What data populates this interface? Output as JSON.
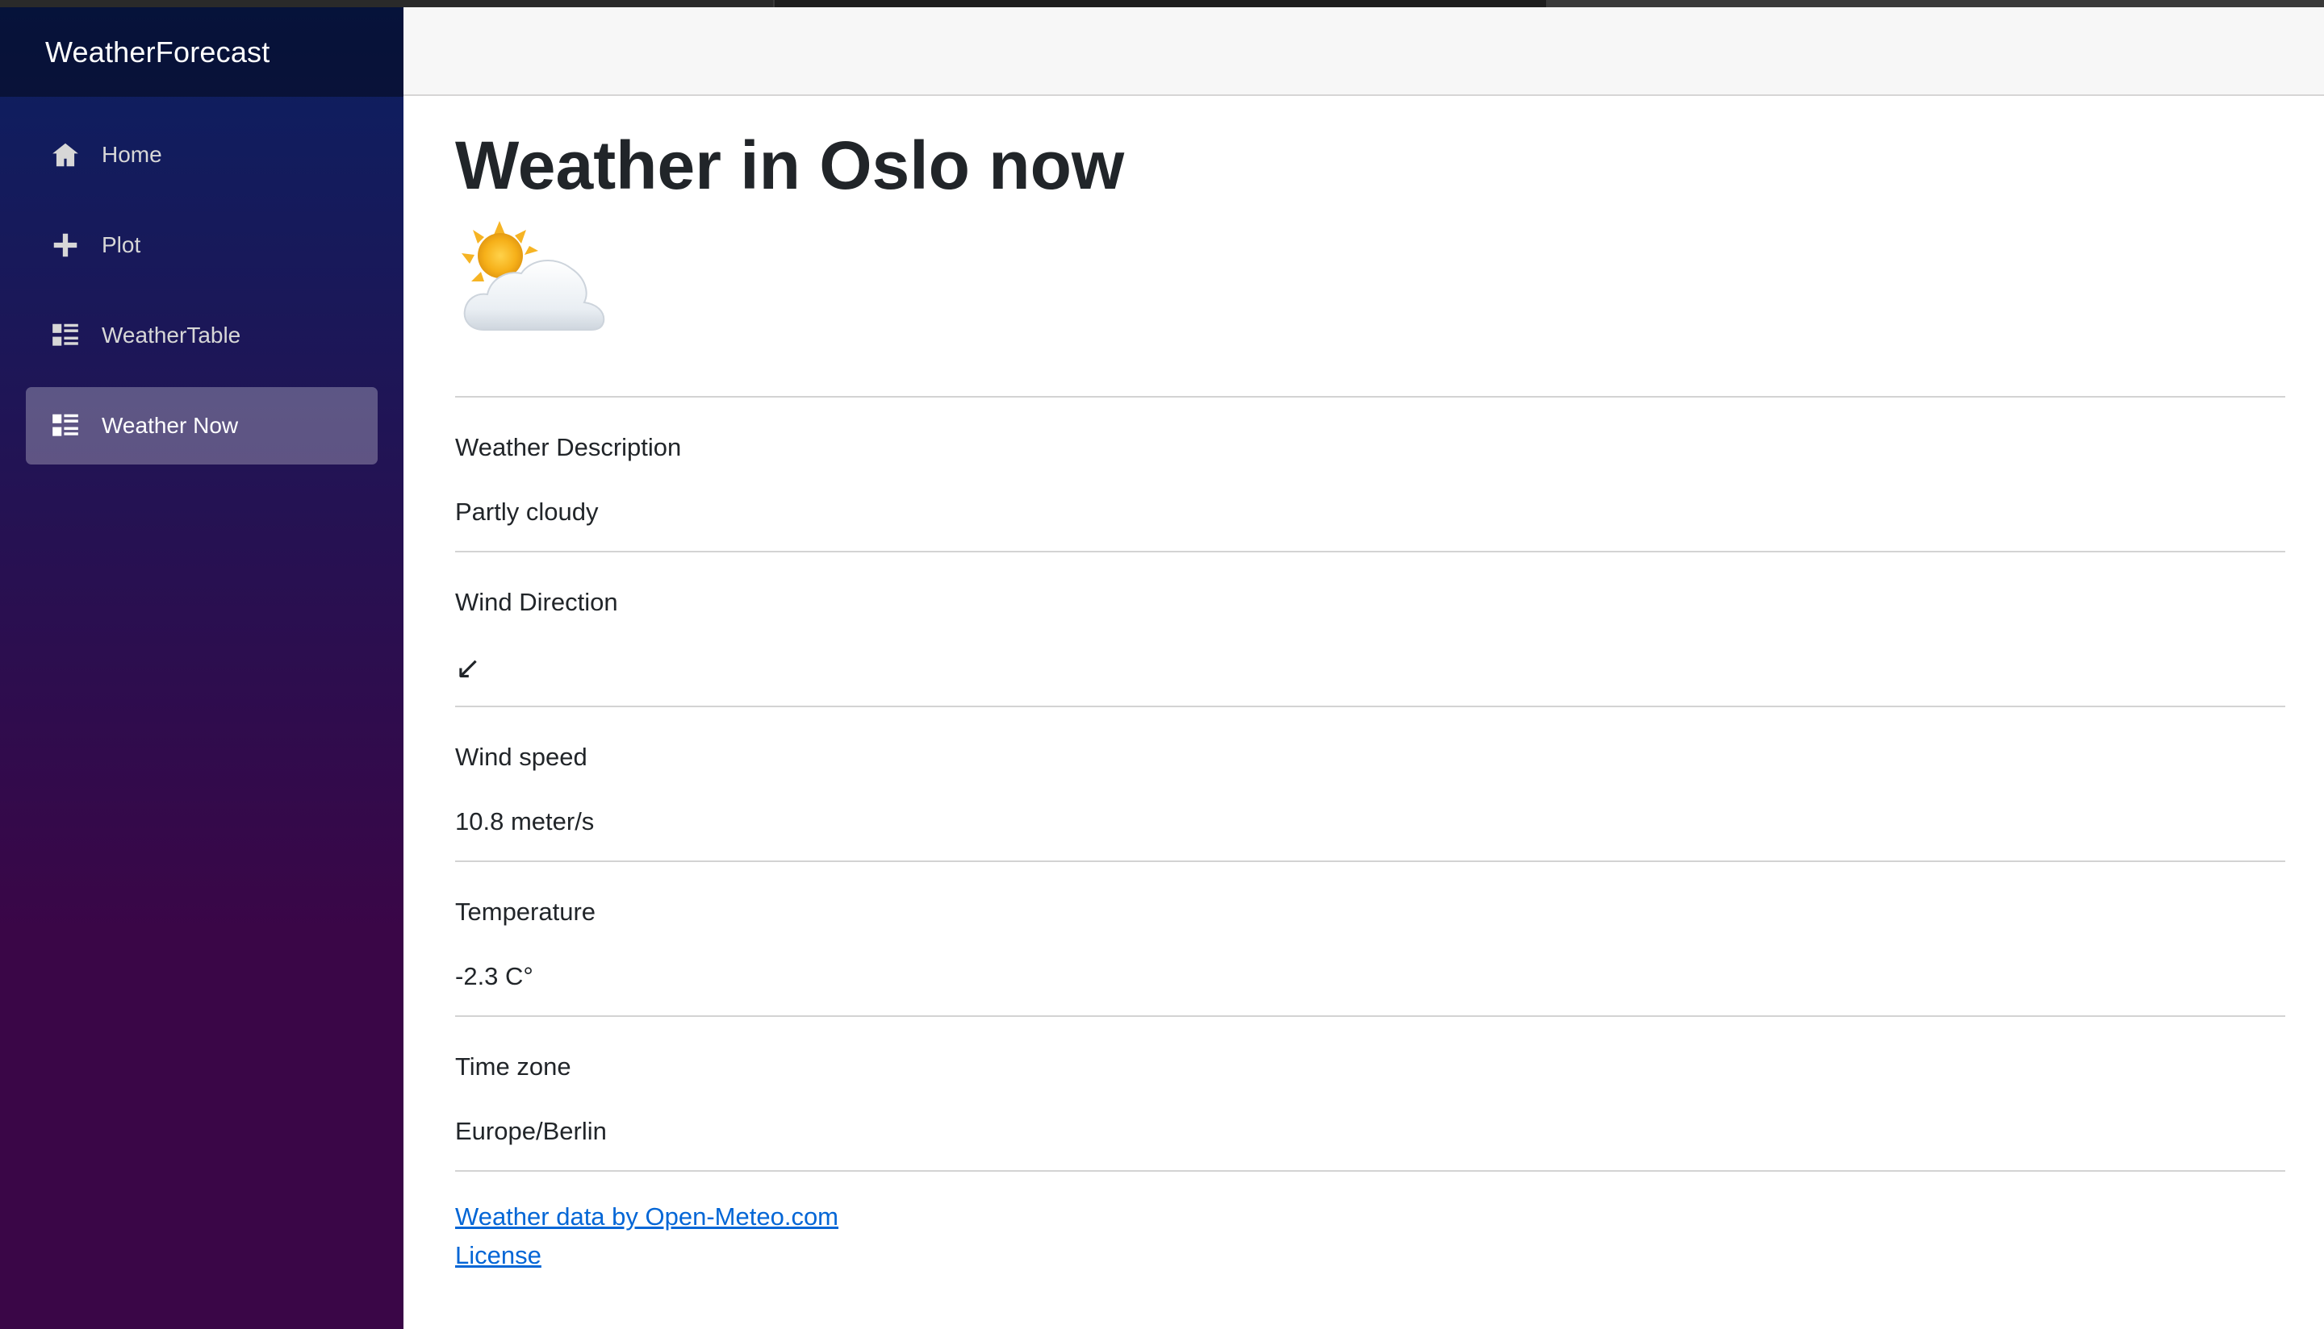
{
  "app": {
    "brand": "WeatherForecast"
  },
  "sidebar": {
    "items": [
      {
        "label": "Home",
        "icon": "home-icon",
        "active": false
      },
      {
        "label": "Plot",
        "icon": "plus-icon",
        "active": false
      },
      {
        "label": "WeatherTable",
        "icon": "list-icon",
        "active": false
      },
      {
        "label": "Weather Now",
        "icon": "list-icon",
        "active": true
      }
    ]
  },
  "main": {
    "title": "Weather in Oslo now",
    "weather_icon": "partly-cloudy-icon",
    "fields": [
      {
        "label": "Weather Description",
        "value": "Partly cloudy"
      },
      {
        "label": "Wind Direction",
        "value": "↙"
      },
      {
        "label": "Wind speed",
        "value": "10.8 meter/s"
      },
      {
        "label": "Temperature",
        "value": "-2.3 C°"
      },
      {
        "label": "Time zone",
        "value": "Europe/Berlin"
      }
    ],
    "links": [
      {
        "label": "Weather data by Open-Meteo.com"
      },
      {
        "label": "License"
      }
    ]
  },
  "colors": {
    "sidebar_top": "#0b2061",
    "sidebar_bottom": "#3a0647",
    "link": "#0366d6",
    "active_nav_bg": "rgba(255,255,255,0.28)"
  }
}
